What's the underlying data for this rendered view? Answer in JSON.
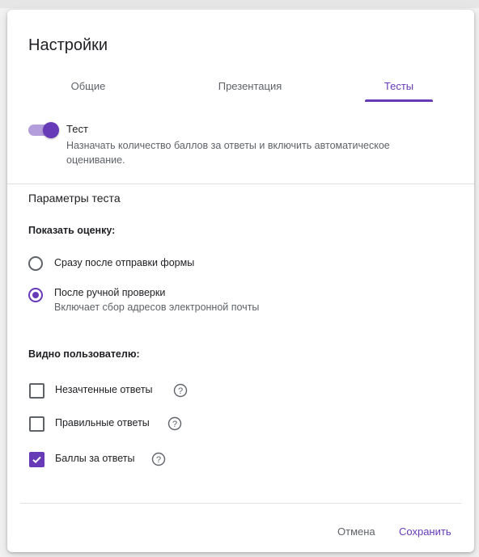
{
  "dialog": {
    "title": "Настройки",
    "tabs": [
      {
        "label": "Общие",
        "active": false
      },
      {
        "label": "Презентация",
        "active": false
      },
      {
        "label": "Тесты",
        "active": true
      }
    ],
    "quiz_toggle": {
      "on": true,
      "label": "Тест",
      "description": "Назначать количество баллов за ответы и включить автоматическое оценивание."
    },
    "quiz_options": {
      "title": "Параметры теста",
      "release_grade": {
        "heading": "Показать оценку:",
        "options": [
          {
            "label": "Сразу после отправки формы",
            "selected": false
          },
          {
            "label": "После ручной проверки",
            "selected": true,
            "description": "Включает сбор адресов электронной почты"
          }
        ]
      },
      "respondent_can_see": {
        "heading": "Видно пользователю:",
        "items": [
          {
            "label": "Незачтенные ответы",
            "checked": false
          },
          {
            "label": "Правильные ответы",
            "checked": false
          },
          {
            "label": "Баллы за ответы",
            "checked": true
          }
        ]
      }
    },
    "actions": {
      "cancel": "Отмена",
      "save": "Сохранить"
    }
  },
  "colors": {
    "accent": "#673ab7",
    "toggle_track": "#b39ddb",
    "secondary_text": "#5f6368"
  },
  "icons": {
    "help": "help-circle-icon",
    "check": "checkmark-icon"
  }
}
